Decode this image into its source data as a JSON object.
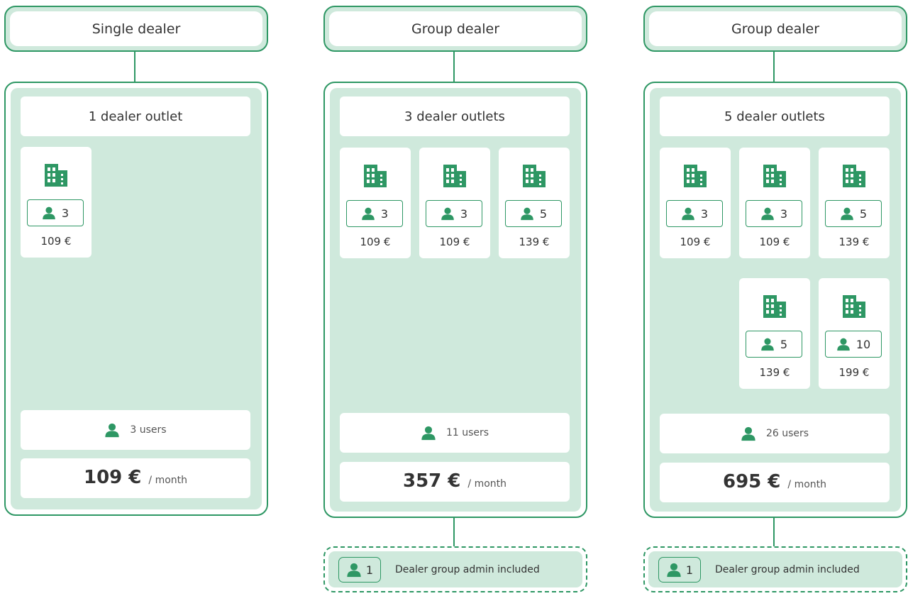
{
  "colors": {
    "accent": "#2e9764",
    "panel_fill": "#cfe9dc",
    "text": "#333333"
  },
  "icons": {
    "outlet": "building-icon",
    "user": "user-icon"
  },
  "columns": [
    {
      "title": "Single dealer",
      "outlets_label": "1 dealer outlet",
      "outlets": [
        {
          "users": "3",
          "price": "109 €"
        }
      ],
      "users_total": "3 users",
      "price_total": "109 €",
      "price_unit": "/ month"
    },
    {
      "title": "Group dealer",
      "outlets_label": "3 dealer outlets",
      "outlets": [
        {
          "users": "3",
          "price": "109 €"
        },
        {
          "users": "3",
          "price": "109 €"
        },
        {
          "users": "5",
          "price": "139 €"
        }
      ],
      "users_total": "11 users",
      "price_total": "357 €",
      "price_unit": "/ month",
      "admin": {
        "count": "1",
        "label": "Dealer group admin included"
      }
    },
    {
      "title": "Group dealer",
      "outlets_label": "5 dealer outlets",
      "outlets": [
        {
          "users": "3",
          "price": "109 €"
        },
        {
          "users": "3",
          "price": "109 €"
        },
        {
          "users": "5",
          "price": "139 €"
        },
        {
          "users": "5",
          "price": "139 €"
        },
        {
          "users": "10",
          "price": "199 €"
        }
      ],
      "users_total": "26 users",
      "price_total": "695 €",
      "price_unit": "/ month",
      "admin": {
        "count": "1",
        "label": "Dealer group admin included"
      }
    }
  ]
}
